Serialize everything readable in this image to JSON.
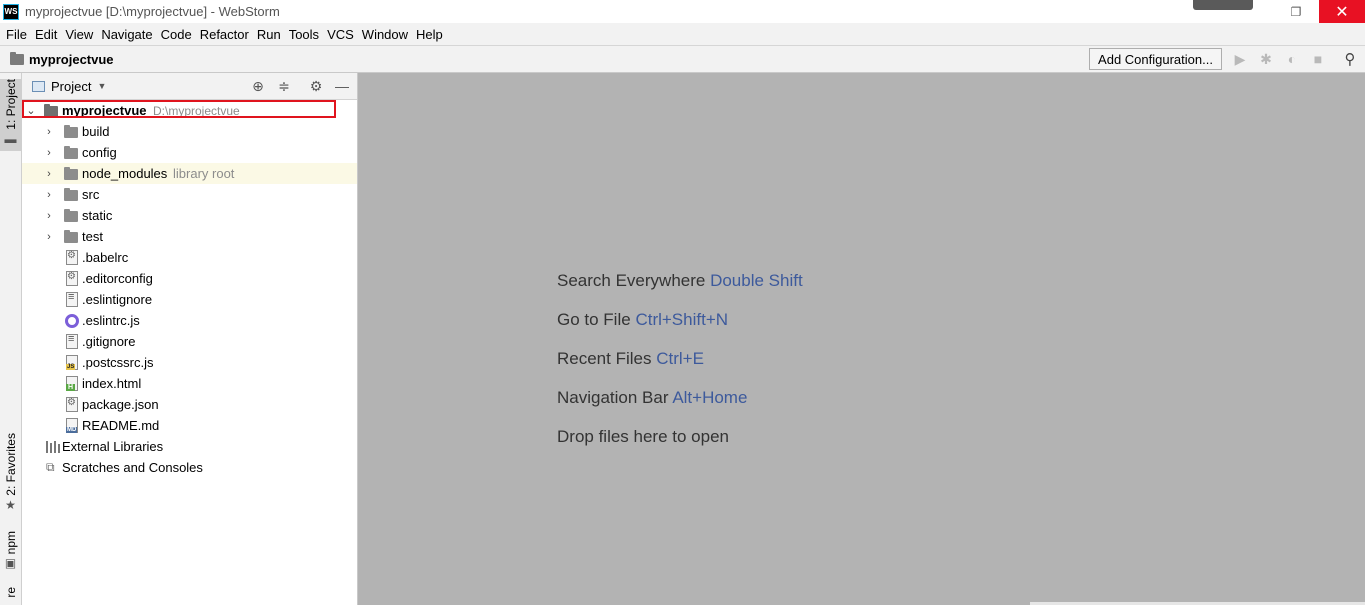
{
  "window": {
    "logo": "WS",
    "title": "myprojectvue [D:\\myprojectvue] - WebStorm",
    "restore_glyph": "❐",
    "close_glyph": "✕"
  },
  "menu": [
    "File",
    "Edit",
    "View",
    "Navigate",
    "Code",
    "Refactor",
    "Run",
    "Tools",
    "VCS",
    "Window",
    "Help"
  ],
  "navbar": {
    "project": "myprojectvue",
    "add_configuration": "Add Configuration...",
    "icons": [
      "run-icon",
      "debug-icon",
      "coverage-icon",
      "stop-icon",
      "search-icon"
    ]
  },
  "left_stripe": {
    "tabs": [
      "1: Project",
      "2: Favorites",
      "npm",
      "re"
    ]
  },
  "project_panel": {
    "title": "Project",
    "header_icons": [
      "locate-icon",
      "collapse-icon",
      "settings-icon",
      "hide-icon"
    ],
    "root": {
      "name": "myprojectvue",
      "path": "D:\\myprojectvue"
    },
    "folders": [
      {
        "name": "build",
        "hint": ""
      },
      {
        "name": "config",
        "hint": ""
      },
      {
        "name": "node_modules",
        "hint": "library root"
      },
      {
        "name": "src",
        "hint": ""
      },
      {
        "name": "static",
        "hint": ""
      },
      {
        "name": "test",
        "hint": ""
      }
    ],
    "files": [
      {
        "name": ".babelrc",
        "icon": "config-file-icon"
      },
      {
        "name": ".editorconfig",
        "icon": "editorconfig-icon"
      },
      {
        "name": ".eslintignore",
        "icon": "text-file-icon"
      },
      {
        "name": ".eslintrc.js",
        "icon": "eslint-icon"
      },
      {
        "name": ".gitignore",
        "icon": "text-file-icon"
      },
      {
        "name": ".postcssrc.js",
        "icon": "js-file-icon"
      },
      {
        "name": "index.html",
        "icon": "html-file-icon"
      },
      {
        "name": "package.json",
        "icon": "json-file-icon"
      },
      {
        "name": "README.md",
        "icon": "markdown-file-icon"
      }
    ],
    "extra": [
      "External Libraries",
      "Scratches and Consoles"
    ]
  },
  "editor": {
    "tips": [
      {
        "text": "Search Everywhere",
        "key": "Double Shift"
      },
      {
        "text": "Go to File",
        "key": "Ctrl+Shift+N"
      },
      {
        "text": "Recent Files",
        "key": "Ctrl+E"
      },
      {
        "text": "Navigation Bar",
        "key": "Alt+Home"
      },
      {
        "text": "Drop files here to open",
        "key": ""
      }
    ]
  }
}
